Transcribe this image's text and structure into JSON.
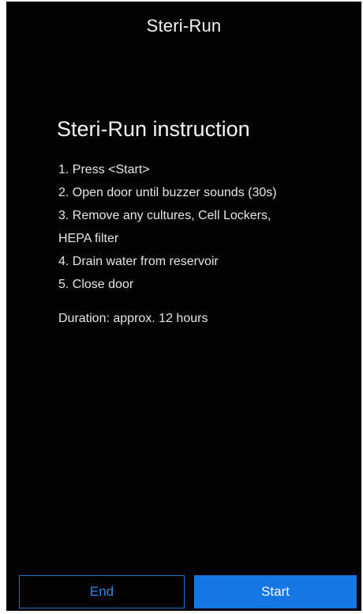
{
  "header": {
    "title": "Steri-Run"
  },
  "instruction": {
    "heading": "Steri-Run instruction",
    "steps": [
      "1. Press <Start>",
      "2. Open door until buzzer sounds (30s)",
      "3. Remove any cultures, Cell Lockers,",
      "HEPA filter",
      "4. Drain water from reservoir",
      "5. Close door"
    ],
    "duration": "Duration: approx. 12 hours"
  },
  "footer": {
    "end_label": "End",
    "start_label": "Start"
  },
  "colors": {
    "background": "#020202",
    "accent": "#1577e4",
    "text": "#f2f2f2"
  }
}
